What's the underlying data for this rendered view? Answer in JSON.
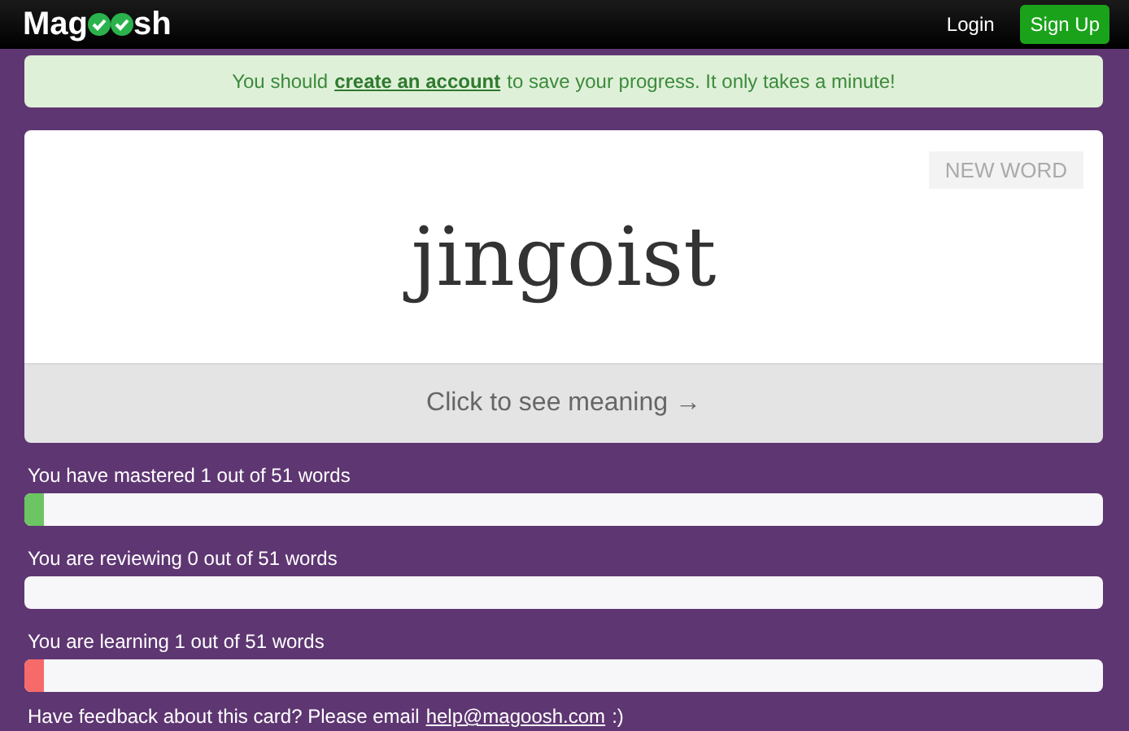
{
  "header": {
    "logo_start": "Mag",
    "logo_end": "sh",
    "login": "Login",
    "signup": "Sign Up"
  },
  "banner": {
    "before": "You should",
    "link": "create an account",
    "after": "to save your progress. It only takes a minute!"
  },
  "card": {
    "new_word": "NEW WORD",
    "word": "jingoist",
    "reveal": "Click to see meaning →"
  },
  "progress": [
    {
      "label": "You have mastered 1 out of 51 words",
      "level": 0.018,
      "color": "#6cc463"
    },
    {
      "label": "You are reviewing 0 out of 51 words"
    },
    {
      "label": "You are learning 1 out of 51 words",
      "level": 0.018,
      "color": "#f76a6a"
    }
  ],
  "feedback": {
    "before": "Have feedback about this card? Please email",
    "link": "help@magoosh.com",
    "after": ":)"
  }
}
